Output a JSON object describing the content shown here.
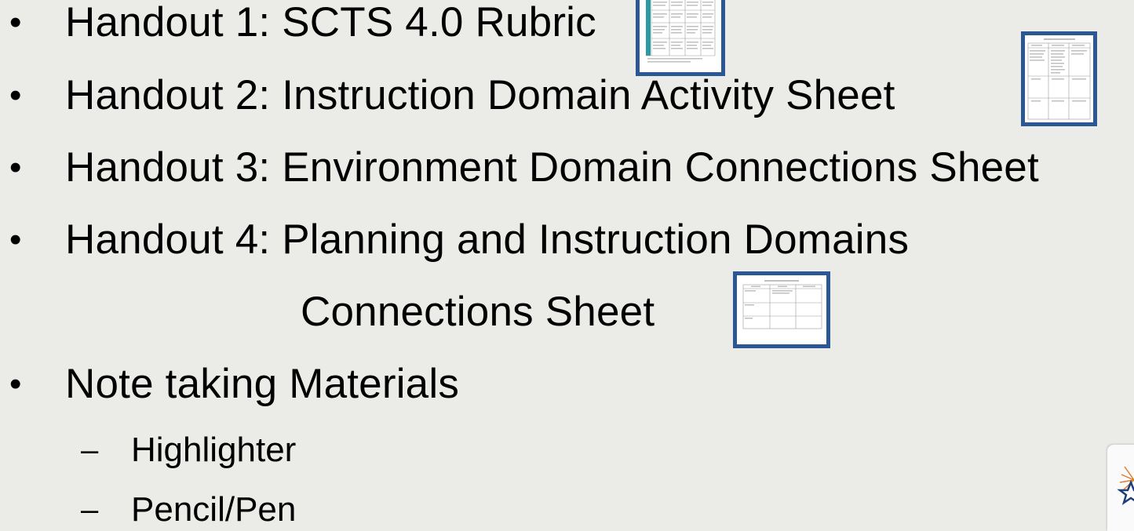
{
  "bullet_glyph": "•",
  "dash_glyph": "–",
  "items": [
    {
      "text": "Handout 1: SCTS 4.0 Rubric"
    },
    {
      "text": "Handout 2: Instruction Domain Activity Sheet"
    },
    {
      "text": "Handout 3: Environment Domain Connections Sheet"
    },
    {
      "text": "Handout 4: Planning and Instruction Domains",
      "continuation": "Connections Sheet"
    },
    {
      "text": "Note taking Materials"
    }
  ],
  "sub_items": [
    {
      "text": "Highlighter"
    },
    {
      "text": "Pencil/Pen"
    }
  ],
  "colors": {
    "background": "#ebebe7",
    "thumbnail_border": "#2b5794",
    "rubric_accent": "#2a9aa3"
  },
  "icons": [
    "rubric-thumbnail-icon",
    "activity-sheet-thumbnail-icon",
    "connections-sheet-thumbnail-icon",
    "logo-icon"
  ]
}
